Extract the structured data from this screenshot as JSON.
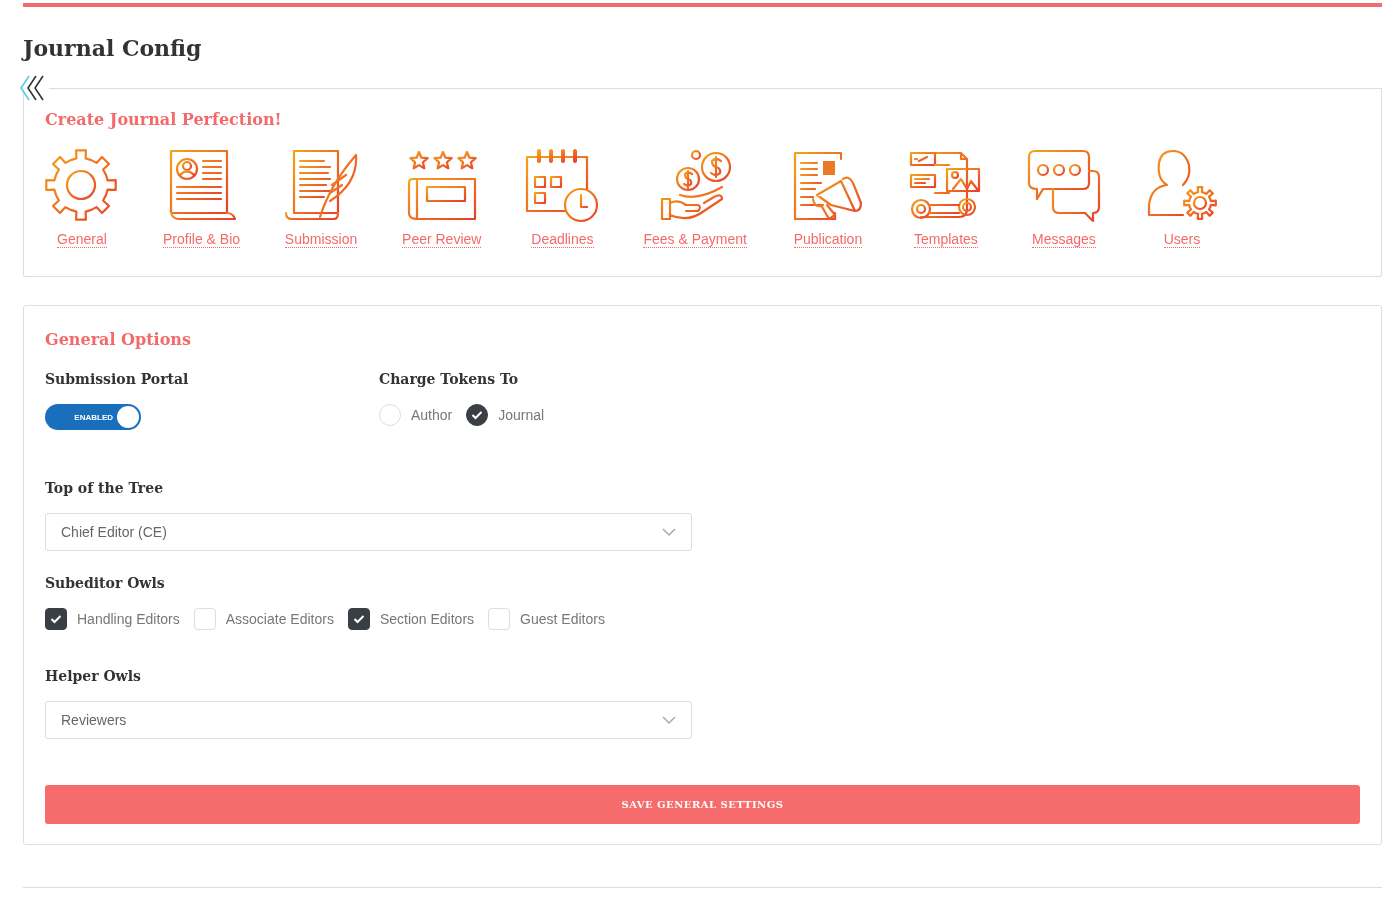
{
  "page": {
    "title": "Journal Config"
  },
  "nav": {
    "heading": "Create Journal Perfection!",
    "items": [
      {
        "label": "General",
        "kind": "gear"
      },
      {
        "label": "Profile & Bio",
        "kind": "profile"
      },
      {
        "label": "Submission",
        "kind": "submission"
      },
      {
        "label": "Peer Review",
        "kind": "review"
      },
      {
        "label": "Deadlines",
        "kind": "deadlines"
      },
      {
        "label": "Fees & Payment",
        "kind": "fees"
      },
      {
        "label": "Publication",
        "kind": "publication"
      },
      {
        "label": "Templates",
        "kind": "templates"
      },
      {
        "label": "Messages",
        "kind": "messages"
      },
      {
        "label": "Users",
        "kind": "users"
      }
    ]
  },
  "general_options": {
    "heading": "General Options",
    "submission_portal": {
      "label": "Submission Portal",
      "toggle": {
        "on": true,
        "text": "ENABLED"
      }
    },
    "charge_tokens": {
      "label": "Charge Tokens To",
      "options": [
        {
          "label": "Author",
          "selected": false
        },
        {
          "label": "Journal",
          "selected": true
        }
      ]
    },
    "top_of_tree": {
      "label": "Top of the Tree",
      "value": "Chief Editor (CE)"
    },
    "subeditor_owls": {
      "label": "Subeditor Owls",
      "options": [
        {
          "label": "Handling Editors",
          "checked": true
        },
        {
          "label": "Associate Editors",
          "checked": false
        },
        {
          "label": "Section Editors",
          "checked": true
        },
        {
          "label": "Guest Editors",
          "checked": false
        }
      ]
    },
    "helper_owls": {
      "label": "Helper Owls",
      "value": "Reviewers"
    },
    "save_button": "SAVE GENERAL SETTINGS"
  }
}
